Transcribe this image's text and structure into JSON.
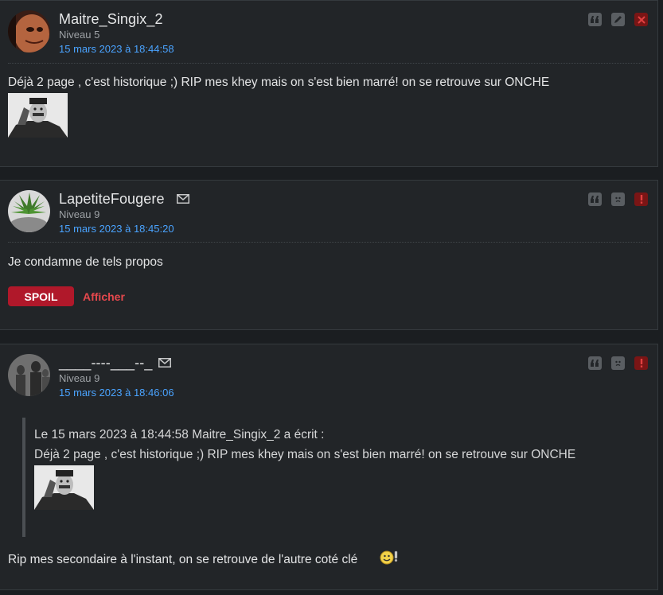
{
  "posts": [
    {
      "author": "Maitre_Singix_2",
      "level": "Niveau 5",
      "date": "15 mars 2023 à 18:44:58",
      "text": "Déjà 2 page , c'est historique ;) RIP mes khey mais on s'est bien marré! on se retrouve sur ONCHE",
      "actions": [
        "quote-icon",
        "edit-icon",
        "delete-icon"
      ]
    },
    {
      "author": "LapetiteFougere",
      "level": "Niveau 9",
      "date": "15 mars 2023 à 18:45:20",
      "text": "Je condamne de tels propos",
      "spoil_label": "SPOIL",
      "spoil_show": "Afficher",
      "actions": [
        "quote-icon",
        "ignore-icon",
        "report-icon"
      ]
    },
    {
      "author": "____----___--_",
      "level": "Niveau 9",
      "date": "15 mars 2023 à 18:46:06",
      "quote_header": "Le 15 mars 2023 à 18:44:58 Maitre_Singix_2 a écrit :",
      "quote_text": "Déjà 2 page , c'est historique ;) RIP mes khey mais on s'est bien marré! on se retrouve sur ONCHE",
      "text": "Rip mes secondaire à l'instant, on se retrouve de l'autre coté clé",
      "actions": [
        "quote-icon",
        "ignore-icon",
        "report-icon"
      ]
    }
  ],
  "colors": {
    "background": "#1b1e21",
    "post_bg": "#222528",
    "date": "#4aa3ff",
    "spoil": "#b0182a",
    "report": "#7a1515"
  }
}
